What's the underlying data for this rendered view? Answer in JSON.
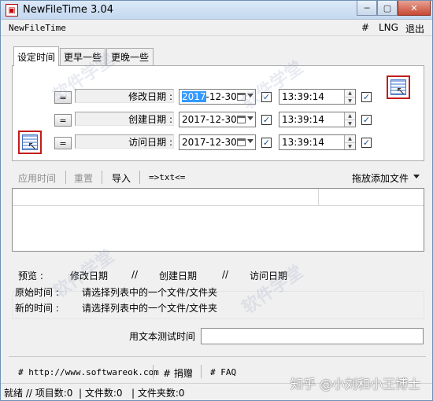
{
  "window": {
    "title": "NewFileTime 3.04",
    "minimize_label": "─",
    "maximize_label": "▢",
    "close_label": "✕"
  },
  "menu": {
    "app_name": "NewFileTime",
    "hash": "#",
    "lng": "LNG",
    "exit": "退出"
  },
  "tabs": [
    "设定时间",
    "更早一些",
    "更晚一些"
  ],
  "rows": [
    {
      "button": "=",
      "label": "修改日期 :",
      "date_selected": "2017",
      "date_rest": "-12-30",
      "time": "13:39:14",
      "date_checked": true,
      "time_checked": true
    },
    {
      "button": "=",
      "label": "创建日期 :",
      "date_selected": "",
      "date_rest": "2017-12-30",
      "time": "13:39:14",
      "date_checked": true,
      "time_checked": true
    },
    {
      "button": "=",
      "label": "访问日期 :",
      "date_selected": "",
      "date_rest": "2017-12-30",
      "time": "13:39:14",
      "date_checked": true,
      "time_checked": true
    }
  ],
  "toolbar": {
    "apply": "应用时间",
    "reset": "重置",
    "import": "导入",
    "txt": "=>txt<=",
    "drag_add": "拖放添加文件"
  },
  "preview": {
    "label": "预览 :",
    "modified": "修改日期",
    "slash1": "//",
    "created": "创建日期",
    "slash2": "//",
    "accessed": "访问日期",
    "original_label": "原始时间 :",
    "original_value": "请选择列表中的一个文件/文件夹",
    "new_label": "新的时间 :",
    "new_value": "请选择列表中的一个文件/文件夹"
  },
  "test_time_label": "用文本测试时间",
  "footer": {
    "url": "# http://www.softwareok.com",
    "donate": "# 捐赠",
    "faq": "# FAQ"
  },
  "status": {
    "text": "就绪 // 项目数:0  | 文件数:0   | 文件夹数:0"
  },
  "overlay": {
    "zhihu": "知乎 @小刘和小王博士"
  }
}
